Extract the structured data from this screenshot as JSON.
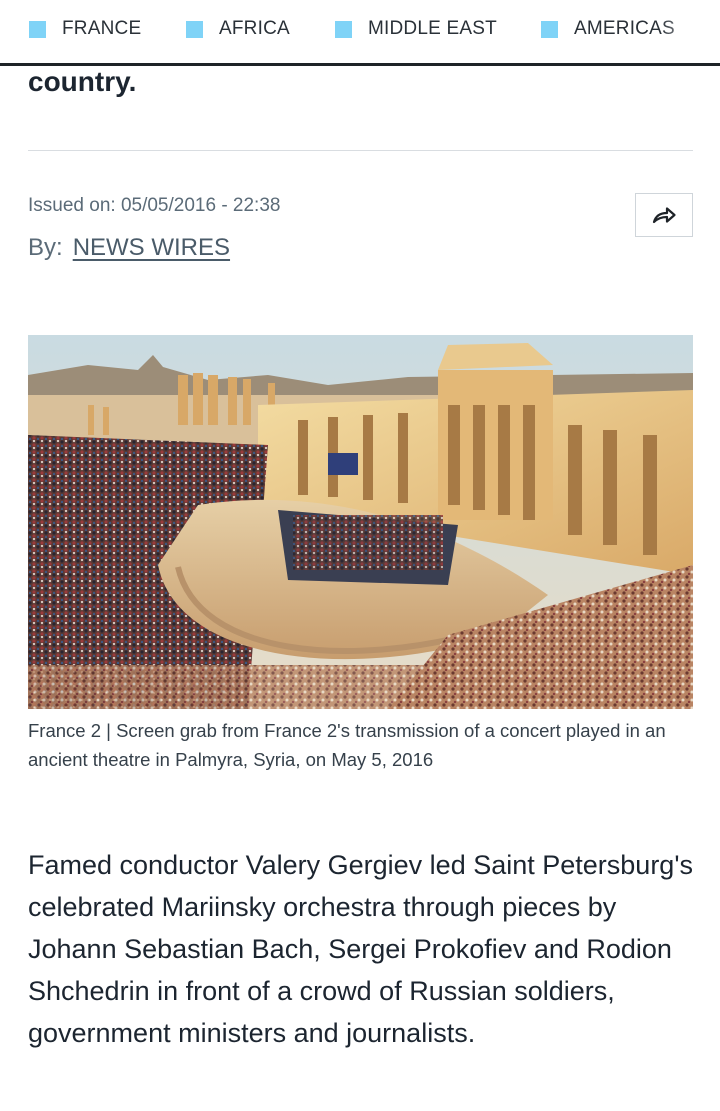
{
  "nav": {
    "items": [
      {
        "label": "FRANCE"
      },
      {
        "label": "AFRICA"
      },
      {
        "label": "MIDDLE EAST"
      },
      {
        "label": "AMERICAS"
      }
    ],
    "accent_color": "#7fd3f7"
  },
  "article": {
    "headline_tail": "country.",
    "issued": "Issued on: 05/05/2016 - 22:38",
    "by_label": "By:",
    "author": "NEWS WIRES",
    "share_icon": "share-arrow-icon",
    "image": {
      "caption": "France 2 | Screen grab from France 2's transmission of a concert played in an ancient theatre in Palmyra, Syria, on May 5, 2016"
    },
    "body": "Famed conductor Valery Gergiev led Saint Petersburg's celebrated Mariinsky orchestra through pieces by Johann Sebastian Bach, Sergei Prokofiev and Rodion Shchedrin in front of a crowd of Russian soldiers, government ministers and journalists."
  }
}
